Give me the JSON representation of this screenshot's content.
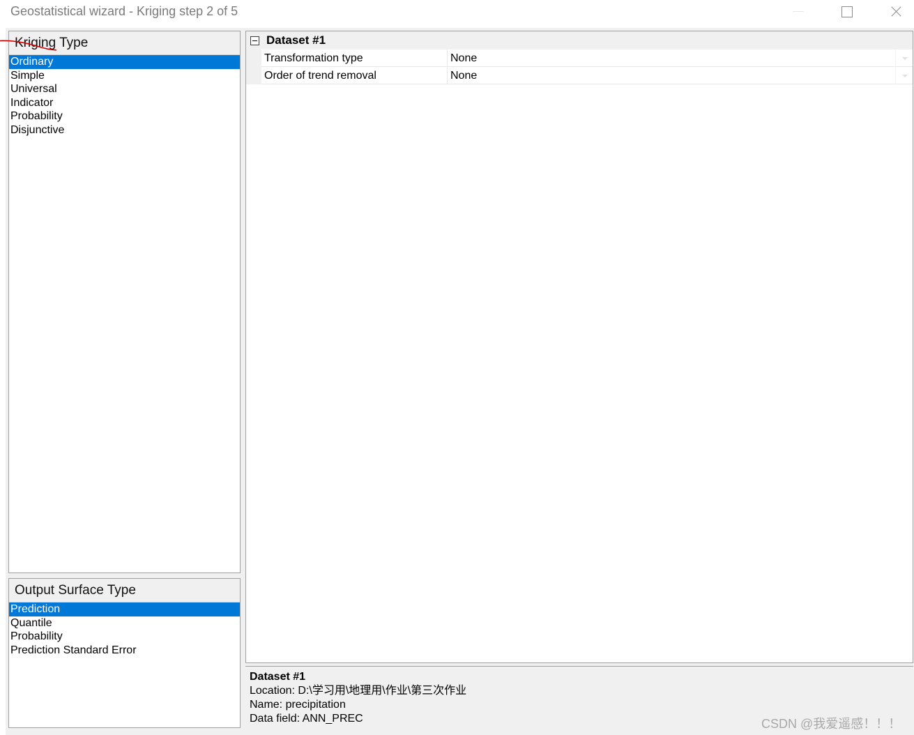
{
  "window": {
    "title": "Geostatistical wizard - Kriging step 2 of 5"
  },
  "kriging_type": {
    "header": "Kriging Type",
    "items": [
      "Ordinary",
      "Simple",
      "Universal",
      "Indicator",
      "Probability",
      "Disjunctive"
    ],
    "selected": "Ordinary"
  },
  "output_surface_type": {
    "header": "Output Surface Type",
    "items": [
      "Prediction",
      "Quantile",
      "Probability",
      "Prediction Standard Error"
    ],
    "selected": "Prediction"
  },
  "property_grid": {
    "category": "Dataset #1",
    "rows": [
      {
        "name": "Transformation type",
        "value": "None"
      },
      {
        "name": "Order of trend removal",
        "value": "None"
      }
    ]
  },
  "description": {
    "title": "Dataset #1",
    "location": "Location: D:\\学习用\\地理用\\作业\\第三次作业",
    "name": "Name: precipitation",
    "data_field": "Data field: ANN_PREC"
  },
  "watermark": "CSDN @我爱遥感！！！",
  "annotation_color": "#d40000",
  "selection_color": "#0078d7"
}
